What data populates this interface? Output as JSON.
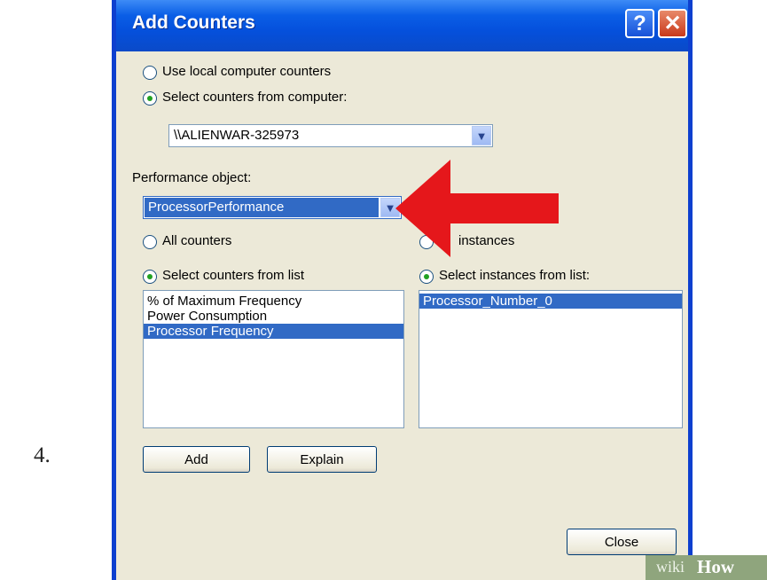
{
  "step_number": "4.",
  "dialog": {
    "title": "Add Counters",
    "help_glyph": "?",
    "close_glyph": "✕",
    "source_options": [
      {
        "label": "Use local computer counters",
        "selected": false
      },
      {
        "label": "Select counters from computer:",
        "selected": true
      }
    ],
    "computer_value": "\\\\ALIENWAR-325973",
    "performance_object_label": "Performance object:",
    "performance_object_value": "ProcessorPerformance",
    "counter_options": [
      {
        "label": "All counters",
        "selected": false
      },
      {
        "label": "Select counters from list",
        "selected": true
      }
    ],
    "instance_options": [
      {
        "label": "instances",
        "selected": false
      },
      {
        "label": "Select instances from list:",
        "selected": true
      }
    ],
    "counters_list": [
      {
        "label": "% of Maximum Frequency",
        "selected": false
      },
      {
        "label": "Power Consumption",
        "selected": false
      },
      {
        "label": "Processor Frequency",
        "selected": true
      }
    ],
    "instances_list": [
      {
        "label": "Processor_Number_0",
        "selected": true
      }
    ],
    "buttons": {
      "add": "Add",
      "explain": "Explain",
      "close": "Close"
    },
    "dropdown_glyph": "▼"
  },
  "annotation_arrow_color": "#e5171b",
  "accent_colors": {
    "titlebar": "#0550dc",
    "selection": "#316ac5",
    "face": "#ece9d8"
  },
  "watermark": {
    "part1": "wiki",
    "part2": "How"
  }
}
